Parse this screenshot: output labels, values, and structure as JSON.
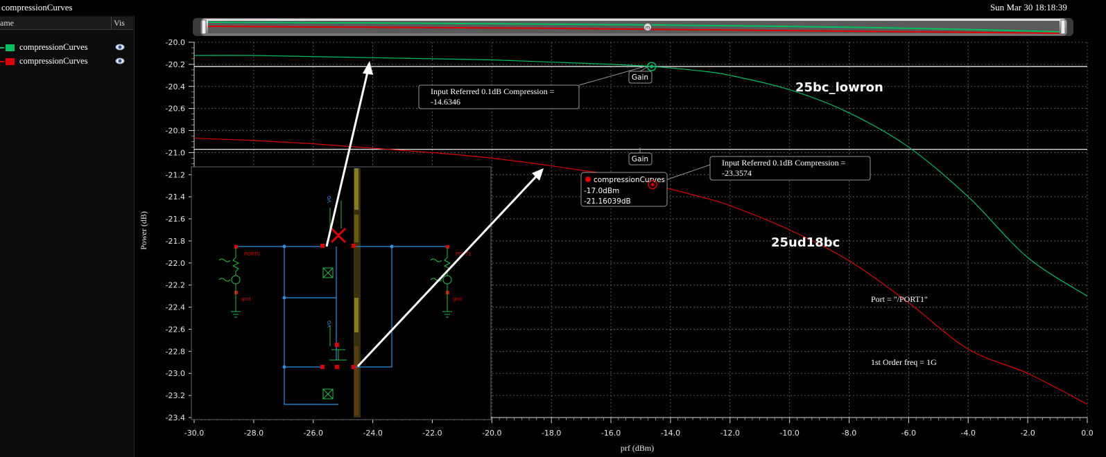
{
  "window": {
    "title": "compressionCurves",
    "datetime": "Sun Mar 30 18:18:39"
  },
  "legend": {
    "header_name": "ame",
    "header_vis": "Vis",
    "items": [
      {
        "label": "compressionCurves",
        "color": "#00c060",
        "icon": "eye-icon"
      },
      {
        "label": "compressionCurves",
        "color": "#e00000",
        "icon": "eye-icon"
      }
    ]
  },
  "annotations": {
    "curve_label_green": "25bc_lowron",
    "curve_label_red": "25ud18bc",
    "port_text": "Port = \"/PORT1\"",
    "freq_text": "1st Order freq = 1G",
    "gain_label_1": "Gain",
    "gain_label_2": "Gain",
    "compression_green_line1": "Input Referred 0.1dB Compression =",
    "compression_green_line2": "-14.6346",
    "compression_red_line1": "Input Referred 0.1dB Compression =",
    "compression_red_line2": "-23.3574",
    "tooltip_title": "compressionCurves",
    "tooltip_x": "-17.0dBm",
    "tooltip_y": "-21.16039dB"
  },
  "schematic": {
    "labels": {
      "vg_top": "VG",
      "vg_bottom": "VG",
      "port_left": "PORT0",
      "port_right": "PORT1",
      "gnd_left": "gnd",
      "gnd_right": "gnd"
    }
  },
  "chart_data": {
    "type": "line",
    "xlabel": "prf (dBm)",
    "ylabel": "Power (dB)",
    "xlim": [
      -30.0,
      0.0
    ],
    "ylim": [
      -23.4,
      -20.0
    ],
    "x_ticks": [
      "-30.0",
      "-28.0",
      "-26.0",
      "-24.0",
      "-22.0",
      "-20.0",
      "-18.0",
      "-16.0",
      "-14.0",
      "-12.0",
      "-10.0",
      "-8.0",
      "-6.0",
      "-4.0",
      "-2.0",
      "0.0"
    ],
    "y_ticks": [
      "-20.0",
      "-20.2",
      "-20.4",
      "-20.6",
      "-20.8",
      "-21.0",
      "-21.2",
      "-21.4",
      "-21.6",
      "-21.8",
      "-22.0",
      "-22.2",
      "-22.4",
      "-22.6",
      "-22.8",
      "-23.0",
      "-23.2",
      "-23.4"
    ],
    "grid": true,
    "reference_lines": [
      -20.22,
      -20.97
    ],
    "markers": [
      {
        "series": "25bc_lowron",
        "x": -14.6346,
        "y": -20.22
      },
      {
        "series": "25ud18bc",
        "x": -14.6,
        "y": -21.29
      }
    ],
    "series": [
      {
        "name": "25bc_lowron",
        "color": "#00c060",
        "x": [
          -30,
          -28,
          -26,
          -24,
          -22,
          -20,
          -18,
          -16,
          -14.6,
          -13,
          -12,
          -10,
          -8,
          -6,
          -4,
          -2,
          0
        ],
        "y": [
          -20.12,
          -20.12,
          -20.13,
          -20.14,
          -20.15,
          -20.16,
          -20.18,
          -20.2,
          -20.22,
          -20.26,
          -20.3,
          -20.43,
          -20.64,
          -20.95,
          -21.4,
          -21.95,
          -22.3
        ]
      },
      {
        "name": "25ud18bc",
        "color": "#e00000",
        "x": [
          -30,
          -28,
          -26,
          -24,
          -22,
          -20,
          -18,
          -17,
          -16,
          -14.6,
          -13,
          -12,
          -10,
          -8,
          -6,
          -4,
          -2,
          0
        ],
        "y": [
          -20.87,
          -20.89,
          -20.92,
          -20.96,
          -21.0,
          -21.05,
          -21.12,
          -21.16,
          -21.2,
          -21.29,
          -21.4,
          -21.48,
          -21.7,
          -21.98,
          -22.36,
          -22.78,
          -23.0,
          -23.28
        ]
      }
    ]
  }
}
